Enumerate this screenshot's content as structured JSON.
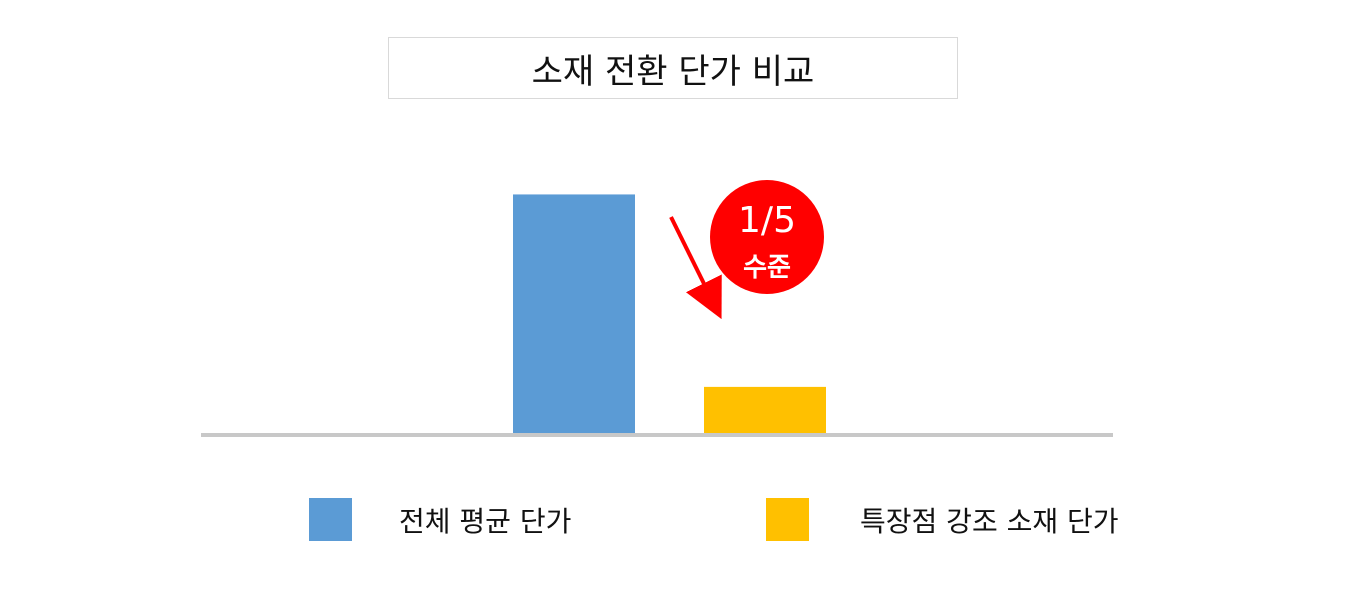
{
  "chart_data": {
    "type": "bar",
    "title": "소재 전환 단가 비교",
    "categories": [
      "전체 평균 단가",
      "특장점 강조 소재 단가"
    ],
    "values": [
      5,
      1
    ],
    "ylim": [
      0,
      5.3
    ],
    "colors": [
      "#5b9bd5",
      "#ffc000"
    ],
    "axis_color": "#c8c8c8",
    "grid": false,
    "legend": {
      "position": "bottom",
      "entries": [
        "전체 평균 단가",
        "특장점 강조 소재 단가"
      ]
    },
    "annotation": {
      "main": "1/5",
      "sub": "수준",
      "color": "#ff0000",
      "arrow": "down-right toward second bar"
    }
  }
}
